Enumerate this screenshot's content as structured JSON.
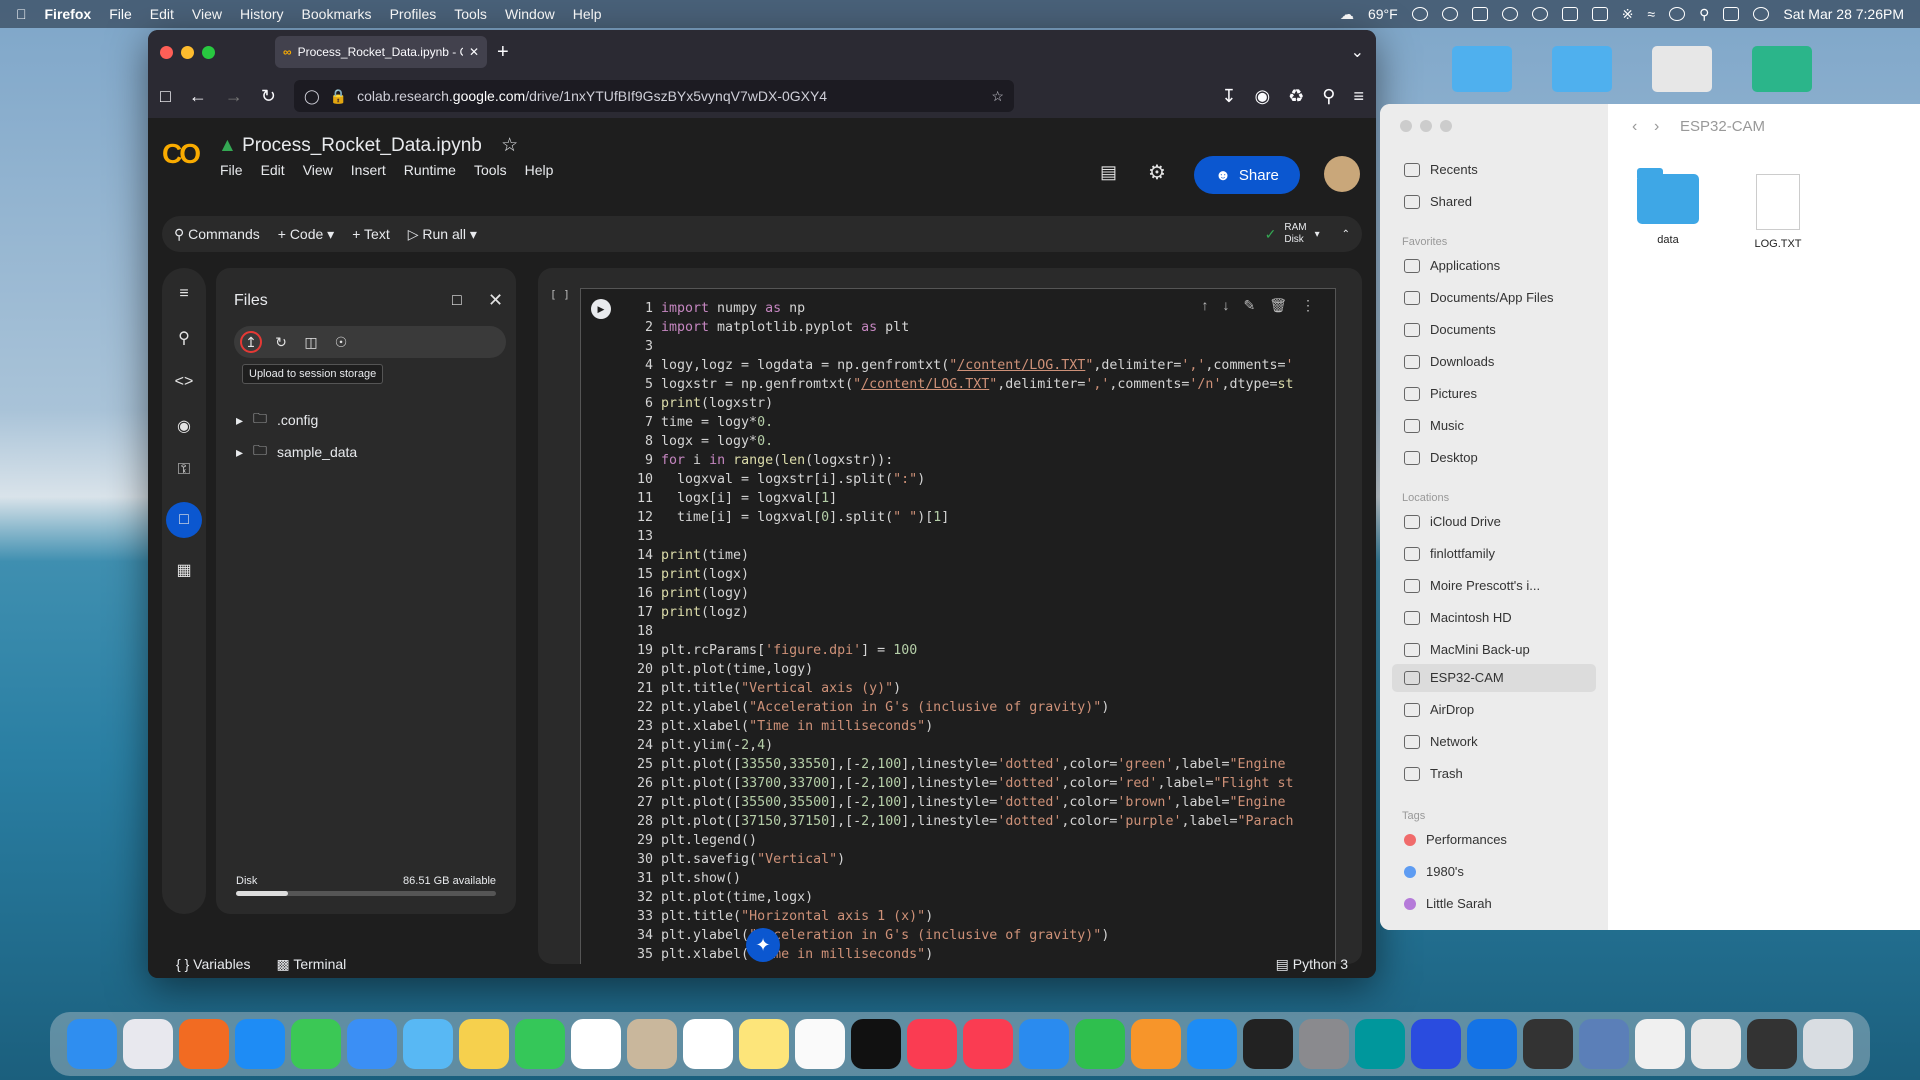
{
  "menubar": {
    "app": "Firefox",
    "items": [
      "File",
      "Edit",
      "View",
      "History",
      "Bookmarks",
      "Profiles",
      "Tools",
      "Window",
      "Help"
    ],
    "weather": "69°F",
    "datetime": "Sat Mar 28  7:26PM"
  },
  "browser": {
    "tab_title": "Process_Rocket_Data.ipynb - C",
    "url_prefix": "colab.research.",
    "url_domain": "google.com",
    "url_rest": "/drive/1nxYTUfBIf9GszBYx5vynqV7wDX-0GXY4"
  },
  "colab": {
    "notebook_title": "Process_Rocket_Data.ipynb",
    "menu": [
      "File",
      "Edit",
      "View",
      "Insert",
      "Runtime",
      "Tools",
      "Help"
    ],
    "share_label": "Share",
    "toolbar": {
      "commands": "Commands",
      "code": "+ Code",
      "text": "+ Text",
      "run_all": "Run all",
      "ram": "RAM",
      "disk": "Disk"
    },
    "files_panel": {
      "title": "Files",
      "tooltip": "Upload to session storage",
      "folders": [
        ".config",
        "sample_data"
      ],
      "disk_label": "Disk",
      "disk_available": "86.51 GB available",
      "disk_used_fraction": 0.2
    },
    "footer": {
      "variables": "Variables",
      "terminal": "Terminal",
      "kernel": "Python 3"
    },
    "cell_bracket": "[ ]"
  },
  "finder": {
    "path": "ESP32-CAM",
    "favorites_label": "Favorites",
    "locations_label": "Locations",
    "tags_label": "Tags",
    "top": [
      "Recents",
      "Shared"
    ],
    "favorites": [
      "Applications",
      "Documents/App Files",
      "Documents",
      "Downloads",
      "Pictures",
      "Music",
      "Desktop"
    ],
    "locations": [
      "iCloud Drive",
      "finlottfamily",
      "Moire Prescott's i...",
      "Macintosh HD",
      "MacMini Back-up",
      "ESP32-CAM",
      "AirDrop",
      "Network",
      "Trash"
    ],
    "tags": [
      {
        "name": "Performances",
        "color": "#f06b6b"
      },
      {
        "name": "1980's",
        "color": "#5e9cf2"
      },
      {
        "name": "Little Sarah",
        "color": "#b57ad9"
      }
    ],
    "files": [
      "data",
      "LOG.TXT"
    ]
  }
}
